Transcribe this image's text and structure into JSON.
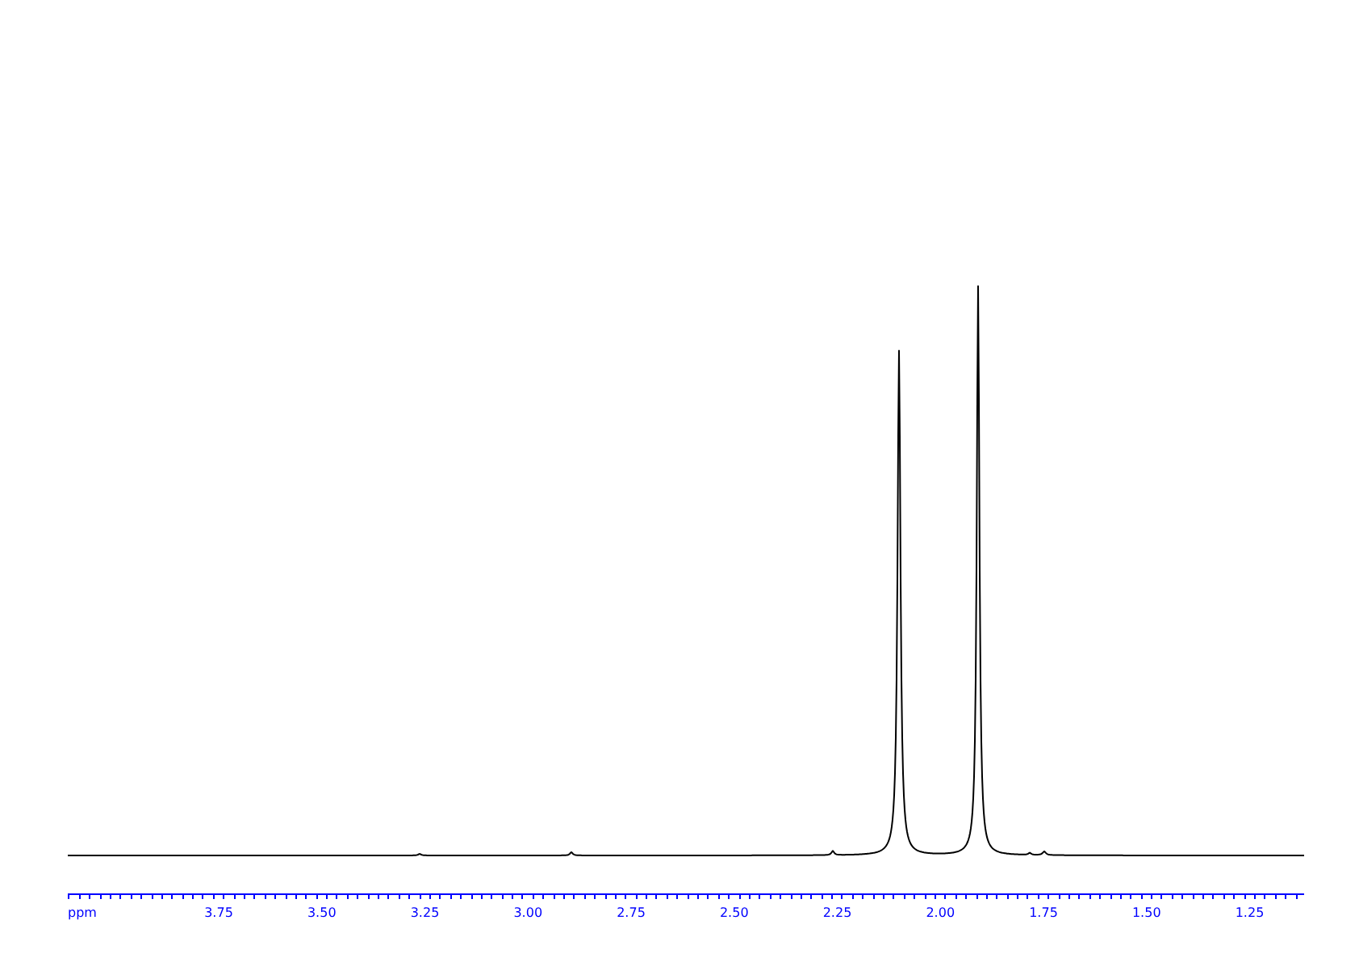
{
  "axis": {
    "unit_label": "ppm",
    "tick_labels": [
      "3.75",
      "3.50",
      "3.25",
      "3.00",
      "2.75",
      "2.50",
      "2.25",
      "2.00",
      "1.75",
      "1.50",
      "1.25"
    ]
  }
}
